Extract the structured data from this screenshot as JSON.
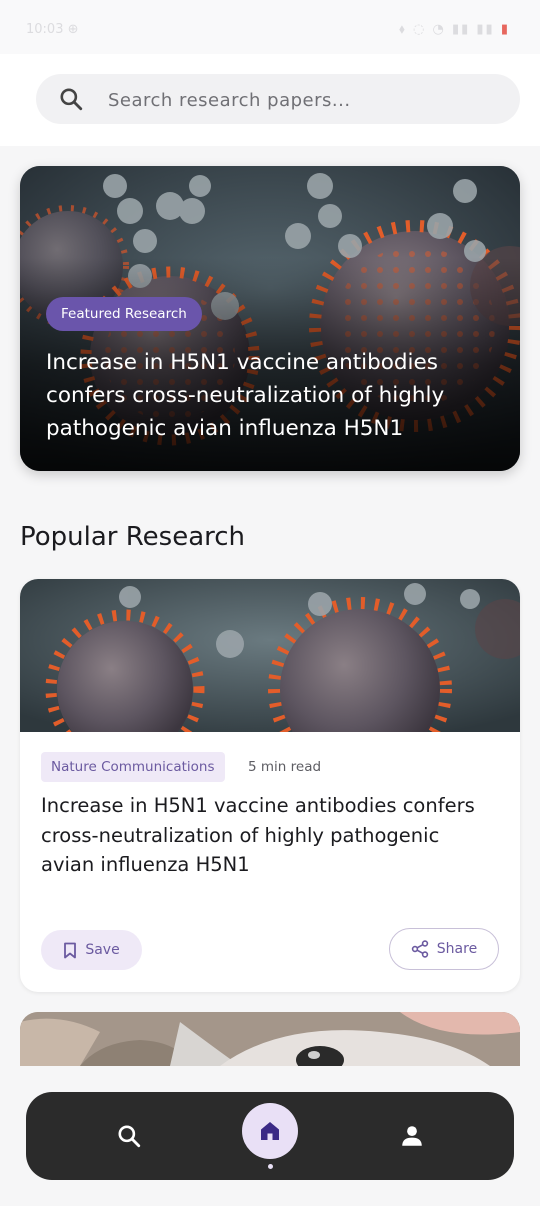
{
  "status_bar": {
    "time": "10:03 ⊕",
    "indicators": "⬧ ◌ ◔ ▮▮ ▮▮",
    "battery": "▮"
  },
  "search": {
    "placeholder": "Search research papers...",
    "icon": "search-icon"
  },
  "featured": {
    "badge": "Featured Research",
    "title": "Increase in H5N1 vaccine antibodies confers cross-neutralization of highly pathogenic avian influenza H5N1",
    "image": "virus-particles-image"
  },
  "popular": {
    "section_title": "Popular Research",
    "cards": [
      {
        "journal": "Nature Communications",
        "read_time": "5 min read",
        "title": "Increase in H5N1 vaccine antibodies confers cross-neutralization of highly pathogenic avian influenza H5N1",
        "save_label": "Save",
        "share_label": "Share",
        "image": "virus-particles-image"
      },
      {
        "image": "mouse-image"
      }
    ]
  },
  "bottom_nav": {
    "items": [
      "search-icon",
      "home-icon",
      "profile-icon"
    ],
    "active": "home-icon"
  },
  "colors": {
    "accent": "#6a55ab",
    "accent_light": "#efe9f7",
    "nav_bg": "#2b2b2b",
    "background": "#f6f6f7"
  }
}
